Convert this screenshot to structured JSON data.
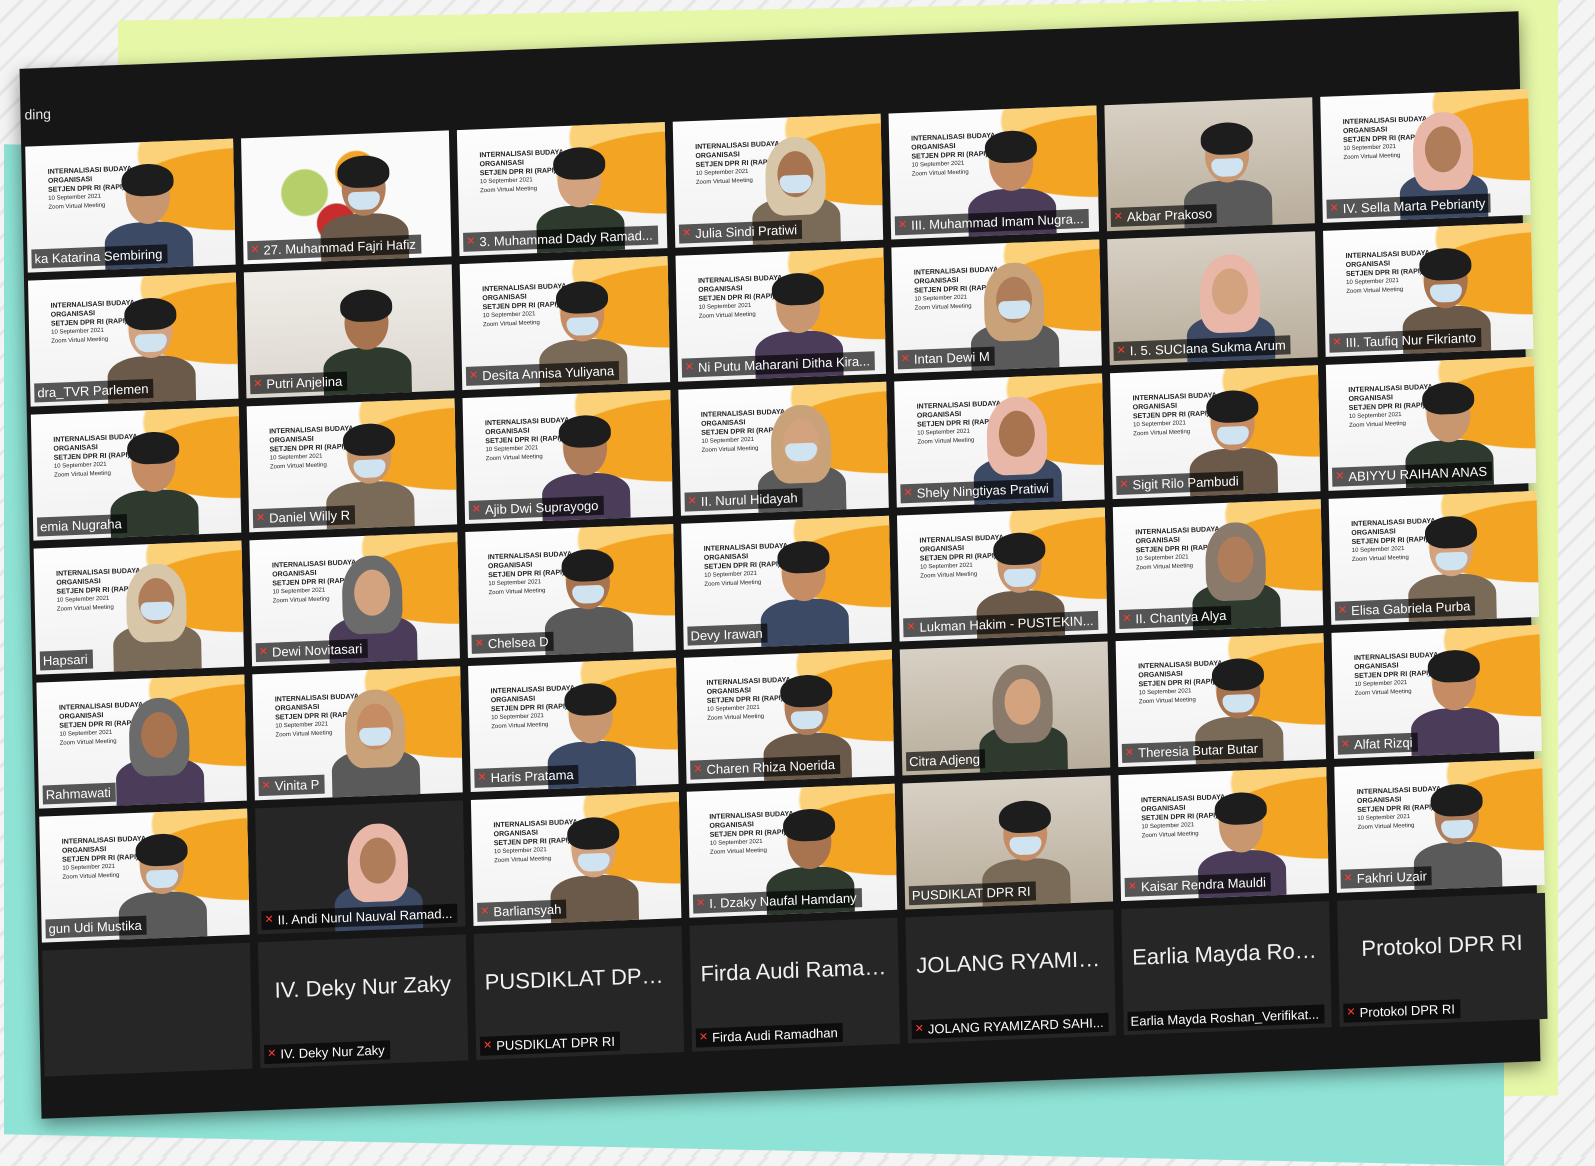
{
  "window": {
    "top_label": "ding"
  },
  "slide_lines": [
    "INTERNALISASI BUDAYA ORGANISASI",
    "SETJEN DPR RI (RAPI) 2021",
    "10 September 2021",
    "Zoom Virtual Meeting"
  ],
  "colors": {
    "accent": "#f3a422",
    "tile_bg": "#2b2b2b",
    "mic_muted": "#ff3b30"
  },
  "participants": [
    {
      "name": "ka Katarina Sembiring",
      "bg": "slide",
      "person": "hair",
      "muted": false
    },
    {
      "name": "27. Muhammad Fajri Hafiz",
      "bg": "fruit",
      "person": "hair",
      "muted": true
    },
    {
      "name": "3. Muhammad Dady Ramad...",
      "bg": "slide",
      "person": "hair",
      "muted": true
    },
    {
      "name": "Julia Sindi Pratiwi",
      "bg": "slide",
      "person": "hijab",
      "muted": true
    },
    {
      "name": "III. Muhammad Imam Nugra...",
      "bg": "slide",
      "person": "hair",
      "muted": true
    },
    {
      "name": "Akbar Prakoso",
      "bg": "office",
      "person": "hair",
      "muted": true
    },
    {
      "name": "IV. Sella Marta Pebrianty",
      "bg": "slide",
      "person": "hijab",
      "muted": true
    },
    {
      "name": "dra_TVR Parlemen",
      "bg": "slide",
      "person": "hair",
      "muted": false
    },
    {
      "name": "Putri Anjelina",
      "bg": "wall",
      "person": "hair",
      "muted": true
    },
    {
      "name": "Desita Annisa Yuliyana",
      "bg": "slide",
      "person": "hair",
      "muted": true
    },
    {
      "name": "Ni Putu Maharani Ditha Kira...",
      "bg": "slide",
      "person": "hair",
      "muted": true
    },
    {
      "name": "Intan Dewi M",
      "bg": "slide",
      "person": "hijab",
      "muted": true
    },
    {
      "name": "I. 5. SUCIana Sukma Arum",
      "bg": "office",
      "person": "hijab",
      "muted": true
    },
    {
      "name": "III. Taufiq Nur Fikrianto",
      "bg": "slide",
      "person": "hair",
      "muted": true
    },
    {
      "name": "emia Nugraha",
      "bg": "slide",
      "person": "hair",
      "muted": false
    },
    {
      "name": "Daniel Willy R",
      "bg": "slide",
      "person": "hair",
      "muted": true
    },
    {
      "name": "Ajib Dwi Suprayogo",
      "bg": "slide",
      "person": "hair",
      "muted": true
    },
    {
      "name": "II. Nurul Hidayah",
      "bg": "slide",
      "person": "hijab",
      "muted": true
    },
    {
      "name": "Shely Ningtiyas Pratiwi",
      "bg": "slide",
      "person": "hijab",
      "muted": true
    },
    {
      "name": "Sigit Rilo Pambudi",
      "bg": "slide",
      "person": "hair",
      "muted": true
    },
    {
      "name": "ABIYYU RAIHAN ANAS",
      "bg": "slide",
      "person": "hair",
      "muted": true
    },
    {
      "name": "Hapsari",
      "bg": "slide",
      "person": "hijab",
      "muted": false
    },
    {
      "name": "Dewi Novitasari",
      "bg": "slide",
      "person": "hijab",
      "muted": true
    },
    {
      "name": "Chelsea D",
      "bg": "slide",
      "person": "hair",
      "muted": true
    },
    {
      "name": "Devy Irawan",
      "bg": "slide",
      "person": "hair",
      "muted": false
    },
    {
      "name": "Lukman Hakim - PUSTEKIN...",
      "bg": "slide",
      "person": "hair",
      "muted": true
    },
    {
      "name": "II. Chantya Alya",
      "bg": "slide",
      "person": "hijab",
      "muted": true
    },
    {
      "name": "Elisa Gabriela Purba",
      "bg": "slide",
      "person": "hair",
      "muted": true
    },
    {
      "name": "Rahmawati",
      "bg": "slide",
      "person": "hijab",
      "muted": false
    },
    {
      "name": "Vinita P",
      "bg": "slide",
      "person": "hijab",
      "muted": true
    },
    {
      "name": "Haris Pratama",
      "bg": "slide",
      "person": "hair",
      "muted": true
    },
    {
      "name": "Charen Rhiza Noerida",
      "bg": "slide",
      "person": "hair",
      "muted": true
    },
    {
      "name": "Citra Adjeng",
      "bg": "office",
      "person": "hijab",
      "muted": false
    },
    {
      "name": "Theresia Butar Butar",
      "bg": "slide",
      "person": "hair",
      "muted": true
    },
    {
      "name": "Alfat Rizqi",
      "bg": "slide",
      "person": "hair",
      "muted": true
    },
    {
      "name": "gun Udi Mustika",
      "bg": "slide",
      "person": "hair",
      "muted": false
    },
    {
      "name": "II. Andi Nurul Nauval Ramad...",
      "bg": "dark",
      "person": "hijab",
      "muted": true
    },
    {
      "name": "Barliansyah",
      "bg": "slide",
      "person": "hair",
      "muted": true
    },
    {
      "name": "I. Dzaky Naufal Hamdany",
      "bg": "slide",
      "person": "hair",
      "muted": true
    },
    {
      "name": "PUSDIKLAT DPR RI",
      "bg": "office",
      "person": "hair",
      "muted": false
    },
    {
      "name": "Kaisar Rendra Mauldi",
      "bg": "slide",
      "person": "hair",
      "muted": true
    },
    {
      "name": "Fakhri Uzair",
      "bg": "slide",
      "person": "hair",
      "muted": true
    }
  ],
  "no_video": [
    {
      "big": "",
      "name": "",
      "muted": false
    },
    {
      "big": "IV. Deky Nur Zaky",
      "name": "IV. Deky Nur Zaky",
      "muted": true
    },
    {
      "big": "PUSDIKLAT DPR RI",
      "name": "PUSDIKLAT DPR RI",
      "muted": true
    },
    {
      "big": "Firda Audi Ramad...",
      "name": "Firda Audi Ramadhan",
      "muted": true
    },
    {
      "big": "JOLANG RYAMIZ...",
      "name": "JOLANG RYAMIZARD SAHI...",
      "muted": true
    },
    {
      "big": "Earlia Mayda Ros...",
      "name": "Earlia Mayda Roshan_Verifikat...",
      "muted": false
    },
    {
      "big": "Protokol DPR RI",
      "name": "Protokol DPR RI",
      "muted": true
    }
  ]
}
